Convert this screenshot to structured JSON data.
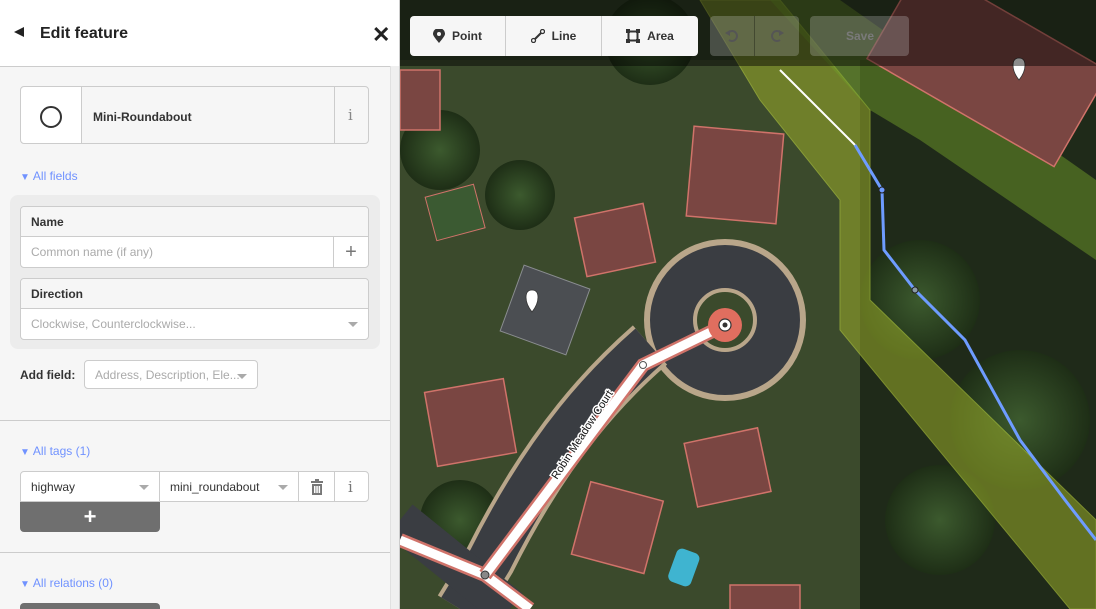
{
  "sidebar": {
    "title": "Edit feature",
    "preset": {
      "name": "Mini-Roundabout",
      "icon": "circle-icon"
    },
    "all_fields_label": "All fields",
    "fields": [
      {
        "label": "Name",
        "placeholder": "Common name (if any)"
      },
      {
        "label": "Direction",
        "placeholder": "Clockwise, Counterclockwise..."
      }
    ],
    "add_field": {
      "label": "Add field:",
      "placeholder": "Address, Description, Ele..."
    },
    "all_tags_label": "All tags (1)",
    "tags": [
      {
        "key": "highway",
        "value": "mini_roundabout"
      }
    ],
    "all_relations_label": "All relations (0)"
  },
  "toolbar": {
    "modes": [
      {
        "label": "Point",
        "icon": "map-pin-icon"
      },
      {
        "label": "Line",
        "icon": "line-icon"
      },
      {
        "label": "Area",
        "icon": "area-icon"
      }
    ],
    "undo_icon": "undo-icon",
    "redo_icon": "redo-icon",
    "save_label": "Save"
  },
  "map": {
    "street_label": "Robin Meadow Court",
    "selected_color": "#e06e5f",
    "waterway_color": "#6e9cff",
    "landuse_color": "#b4c832"
  }
}
